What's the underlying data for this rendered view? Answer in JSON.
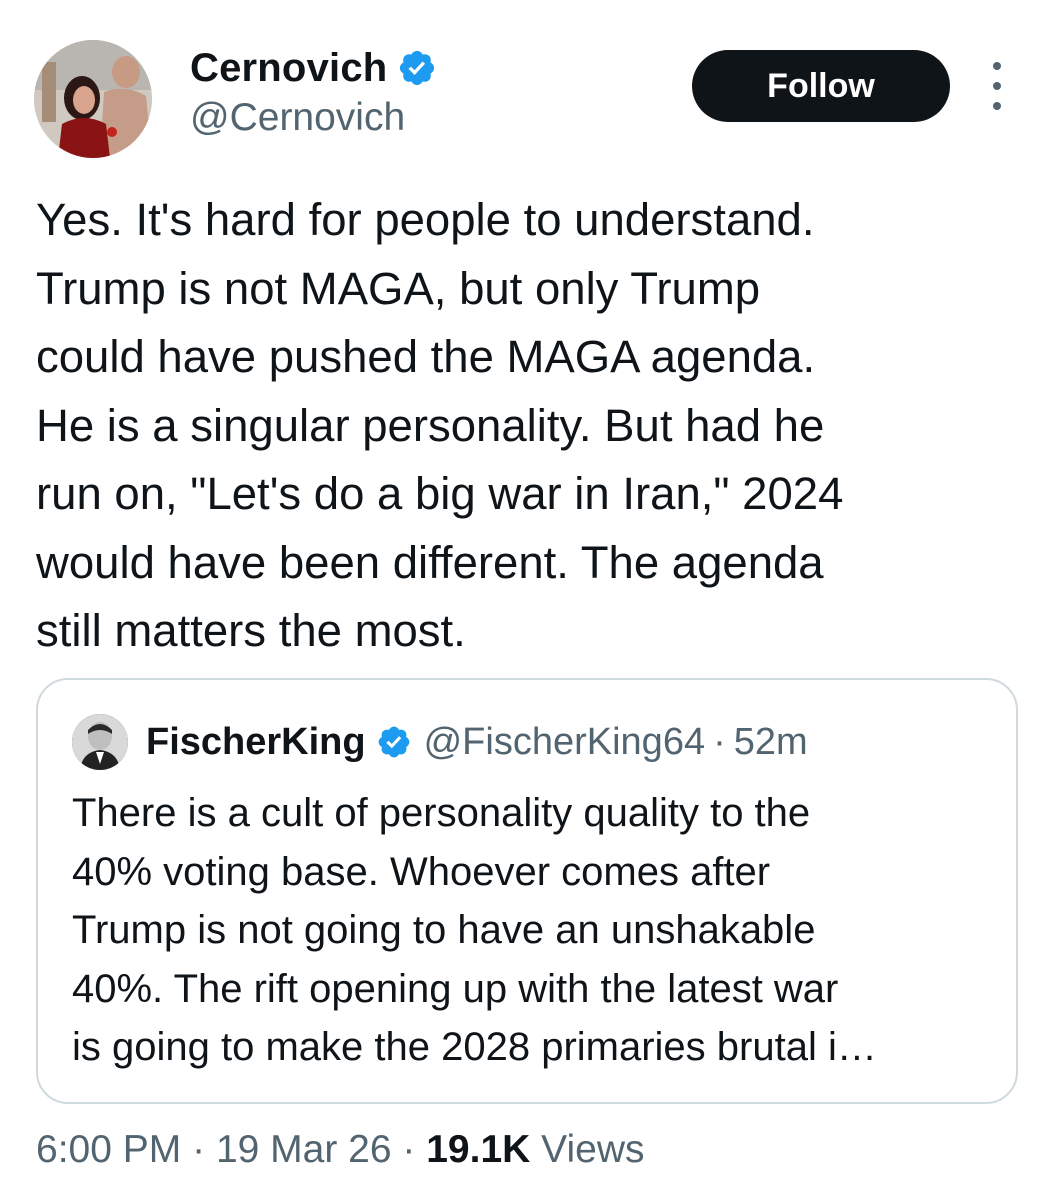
{
  "author": {
    "display_name": "Cernovich",
    "handle": "@Cernovich",
    "verified_icon": "verified-badge-icon"
  },
  "actions": {
    "follow_label": "Follow",
    "more_icon": "more-vertical-icon"
  },
  "tweet": {
    "text": "Yes. It's hard for people to understand.\nTrump is not MAGA, but only Trump\ncould have pushed the MAGA agenda.\nHe is a singular personality. But had he\nrun on, \"Let's do a big war in Iran,\" 2024\nwould have been different. The agenda\nstill matters the most."
  },
  "quoted_tweet": {
    "display_name": "FischerKing",
    "handle": "@FischerKing64",
    "separator": "·",
    "time": "52m",
    "text": "There is a cult of personality quality to the\n40% voting base. Whoever comes after\nTrump is not going to have an unshakable\n40%. The rift opening up with the latest war\nis going to make the 2028 primaries brutal i…"
  },
  "meta": {
    "time": "6:00 PM",
    "separator": "·",
    "date": "19 Mar 26",
    "views_count": "19.1K",
    "views_label": "Views"
  },
  "colors": {
    "text_primary": "#0f1419",
    "text_secondary": "#536471",
    "verified_blue": "#1d9bf0",
    "border": "#cfd9de",
    "follow_bg": "#0f1419"
  }
}
